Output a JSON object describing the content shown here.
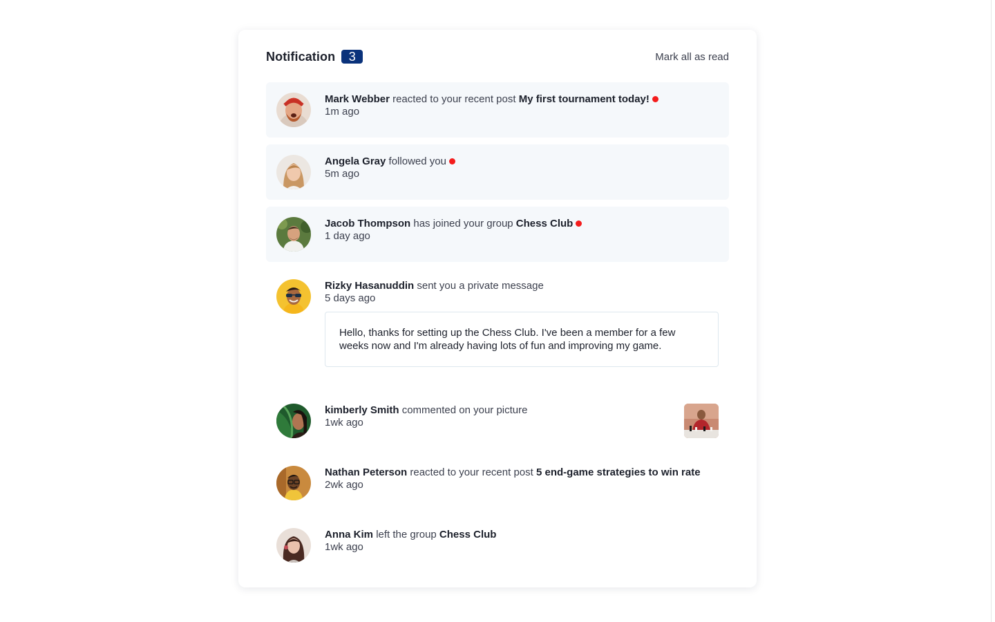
{
  "header": {
    "title": "Notification",
    "unread_count": "3",
    "mark_all_label": "Mark all as read"
  },
  "colors": {
    "badge_bg": "#0a327b",
    "unread_bg": "#f5f8fb",
    "unread_dot": "#f41c1c"
  },
  "notifications": [
    {
      "name": "Mark Webber",
      "action": "reacted to your recent post",
      "target": "My first tournament today!",
      "time": "1m ago",
      "unread": true,
      "avatar_icon": "avatar-mark-webber"
    },
    {
      "name": "Angela Gray",
      "action": "followed you",
      "target": "",
      "time": "5m ago",
      "unread": true,
      "avatar_icon": "avatar-angela-gray"
    },
    {
      "name": "Jacob Thompson",
      "action": "has joined your group",
      "target": "Chess Club",
      "time": "1 day ago",
      "unread": true,
      "avatar_icon": "avatar-jacob-thompson"
    },
    {
      "name": "Rizky Hasanuddin",
      "action": "sent you a private message",
      "target": "",
      "time": "5 days ago",
      "unread": false,
      "message": "Hello, thanks for setting up the Chess Club. I've been a member for a few weeks now and I'm already having lots of fun and improving my game.",
      "avatar_icon": "avatar-rizky-hasanuddin"
    },
    {
      "name": "kimberly Smith",
      "action": "commented on your picture",
      "target": "",
      "time": "1wk ago",
      "unread": false,
      "avatar_icon": "avatar-kimberly-smith",
      "thumbnail_icon": "chess-picture-thumbnail"
    },
    {
      "name": "Nathan Peterson",
      "action": "reacted to your recent post",
      "target": "5 end-game strategies to win rate",
      "time": "2wk ago",
      "unread": false,
      "avatar_icon": "avatar-nathan-peterson"
    },
    {
      "name": "Anna Kim",
      "action": "left the group",
      "target": "Chess Club",
      "time": "1wk ago",
      "unread": false,
      "avatar_icon": "avatar-anna-kim"
    }
  ]
}
